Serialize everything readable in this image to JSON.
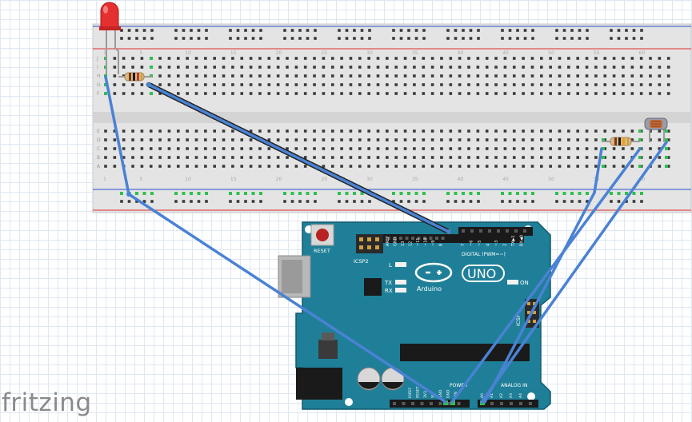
{
  "app": {
    "logo_text": "fritzing"
  },
  "breadboard": {
    "row_letters_top": [
      "J",
      "I",
      "H",
      "G",
      "F"
    ],
    "row_letters_bottom": [
      "E",
      "D",
      "C",
      "B",
      "A"
    ],
    "column_numbers": [
      "1",
      "5",
      "10",
      "15",
      "20",
      "25",
      "30",
      "35",
      "40",
      "45",
      "50",
      "55",
      "60"
    ]
  },
  "arduino": {
    "model": "UNO",
    "brand": "Arduino",
    "reset_label": "RESET",
    "icsp2_label": "ICSP2",
    "icsp_label": "ICSP",
    "led_l_label": "L",
    "tx_label": "TX",
    "rx_label": "RX",
    "on_label": "ON",
    "digital_label": "DIGITAL (PWM=~)",
    "digital_pins": [
      "AREF",
      "GND",
      "13",
      "12",
      "~11",
      "~10",
      "~9",
      "8",
      "7",
      "~6",
      "~5",
      "4",
      "~3",
      "2",
      "TX▶1",
      "RX◀0"
    ],
    "power_label": "POWER",
    "power_pins": [
      "IOREF",
      "RESET",
      "3V3",
      "5V",
      "GND",
      "GND",
      "VIN"
    ],
    "analog_label": "ANALOG IN",
    "analog_pins": [
      "A0",
      "A1",
      "A2",
      "A3",
      "A4",
      "A5"
    ]
  },
  "components": [
    "led-red",
    "resistor-led",
    "resistor-ldr",
    "photocell"
  ],
  "colors": {
    "wire": "#4a82d4",
    "board": "#1f7f98",
    "breadboard": "#e2e2e2",
    "rail_red": "#e05050",
    "rail_blue": "#4a6fd0",
    "hole": "#3a3a3a",
    "led": "#e02020"
  }
}
